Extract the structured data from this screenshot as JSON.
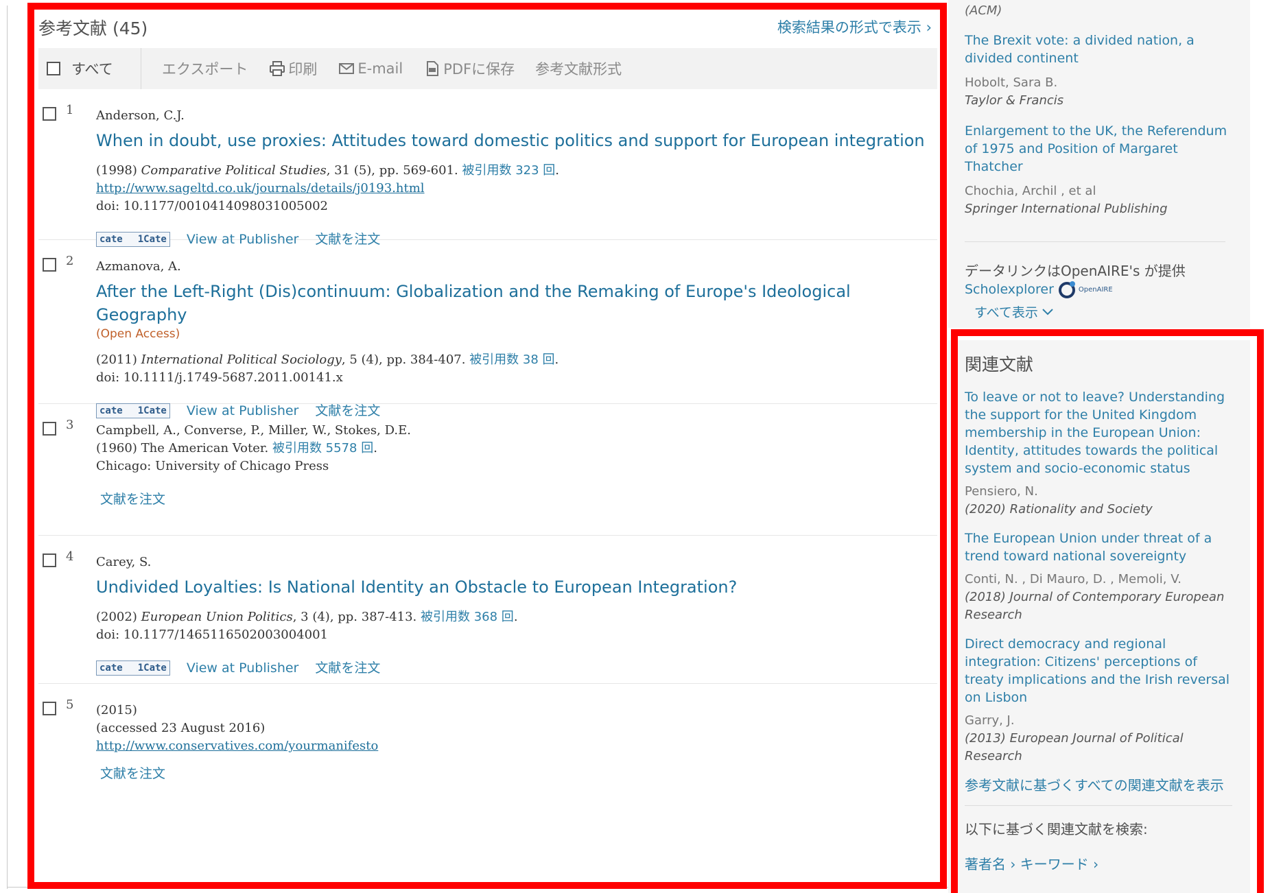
{
  "references": {
    "title": "参考文献",
    "count": "(45)",
    "format_link": "検索結果の形式で表示 ›",
    "toolbar": {
      "select_all": "すべて",
      "export": "エクスポート",
      "print": "印刷",
      "email": "E-mail",
      "pdf": "PDFに保存",
      "ref_format": "参考文献形式"
    },
    "items": [
      {
        "num": "1",
        "authors": "Anderson, C.J.",
        "title": "When in doubt, use proxies: Attitudes toward domestic politics and support for European integration",
        "year": "(1998)",
        "journal": "Comparative Political Studies",
        "details": ", 31 (5), pp. 569-601.",
        "cited": "被引用数 323 回",
        "url": "http://www.sageltd.co.uk/journals/details/j0193.html",
        "doi": "doi: 10.1177/0010414098031005002",
        "cate_a": "cate",
        "cate_b": "1Cate",
        "view_publisher": "View at Publisher",
        "order": "文献を注文"
      },
      {
        "num": "2",
        "authors": "Azmanova, A.",
        "title": "After the Left-Right (Dis)continuum: Globalization and the Remaking of Europe's Ideological Geography",
        "open_access": "(Open Access)",
        "year": "(2011)",
        "journal": "International Political Sociology",
        "details": ", 5 (4), pp. 384-407.",
        "cited": "被引用数 38 回",
        "doi": "doi: 10.1111/j.1749-5687.2011.00141.x",
        "cate_a": "cate",
        "cate_b": "1Cate",
        "view_publisher": "View at Publisher",
        "order": "文献を注文"
      },
      {
        "num": "3",
        "authors": "Campbell, A., Converse, P., Miller, W., Stokes, D.E.",
        "year": "(1960)",
        "journal": "The American Voter",
        "cited": "被引用数 5578 回",
        "publisher": "Chicago: University of Chicago Press",
        "order": "文献を注文"
      },
      {
        "num": "4",
        "authors": "Carey, S.",
        "title": "Undivided Loyalties: Is National Identity an Obstacle to European Integration?",
        "year": "(2002)",
        "journal": "European Union Politics",
        "details": ", 3 (4), pp. 387-413.",
        "cited": "被引用数 368 回",
        "doi": "doi: 10.1177/1465116502003004001",
        "cate_a": "cate",
        "cate_b": "1Cate",
        "view_publisher": "View at Publisher",
        "order": "文献を注文"
      },
      {
        "num": "5",
        "year": "(2015)",
        "accessed": "(accessed 23 August 2016)",
        "url": "http://www.conservatives.com/yourmanifesto",
        "order": "文献を注文"
      }
    ]
  },
  "right_upper": {
    "acm": "(ACM)",
    "entries": [
      {
        "title": "The Brexit vote: a divided nation, a divided continent",
        "author": "Hobolt, Sara B.",
        "publisher": "Taylor & Francis"
      },
      {
        "title": "Enlargement to the UK, the Referendum of 1975 and Position of Margaret Thatcher",
        "author": "Chochia, Archil , et al",
        "publisher": "Springer International Publishing"
      }
    ],
    "datalink_text": "データリンクはOpenAIRE's が提供",
    "scholexplorer": "Scholexplorer",
    "openaire": "OpenAIRE",
    "show_all": "すべて表示"
  },
  "related": {
    "heading": "関連文献",
    "items": [
      {
        "title": "To leave or not to leave? Understanding the support for the United Kingdom membership in the European Union: Identity, attitudes towards the political system and socio-economic status",
        "author": "Pensiero, N.",
        "source": "(2020) Rationality and Society"
      },
      {
        "title": "The European Union under threat of a trend toward national sovereignty",
        "author": "Conti, N. , Di Mauro, D. , Memoli, V.",
        "source": "(2018) Journal of Contemporary European Research"
      },
      {
        "title": "Direct democracy and regional integration: Citizens' perceptions of treaty implications and the Irish reversal on Lisbon",
        "author": "Garry, J.",
        "source": "(2013) European Journal of Political Research"
      }
    ],
    "view_all": "参考文献に基づくすべての関連文献を表示",
    "search_based": "以下に基づく関連文献を検索:",
    "author_link": "著者名 ›",
    "keyword_link": "キーワード ›"
  },
  "colors": {
    "link": "#2e7fa8",
    "title_link": "#1d6f9a",
    "open_access": "#c0602a",
    "annotation_red": "#ff0000"
  }
}
